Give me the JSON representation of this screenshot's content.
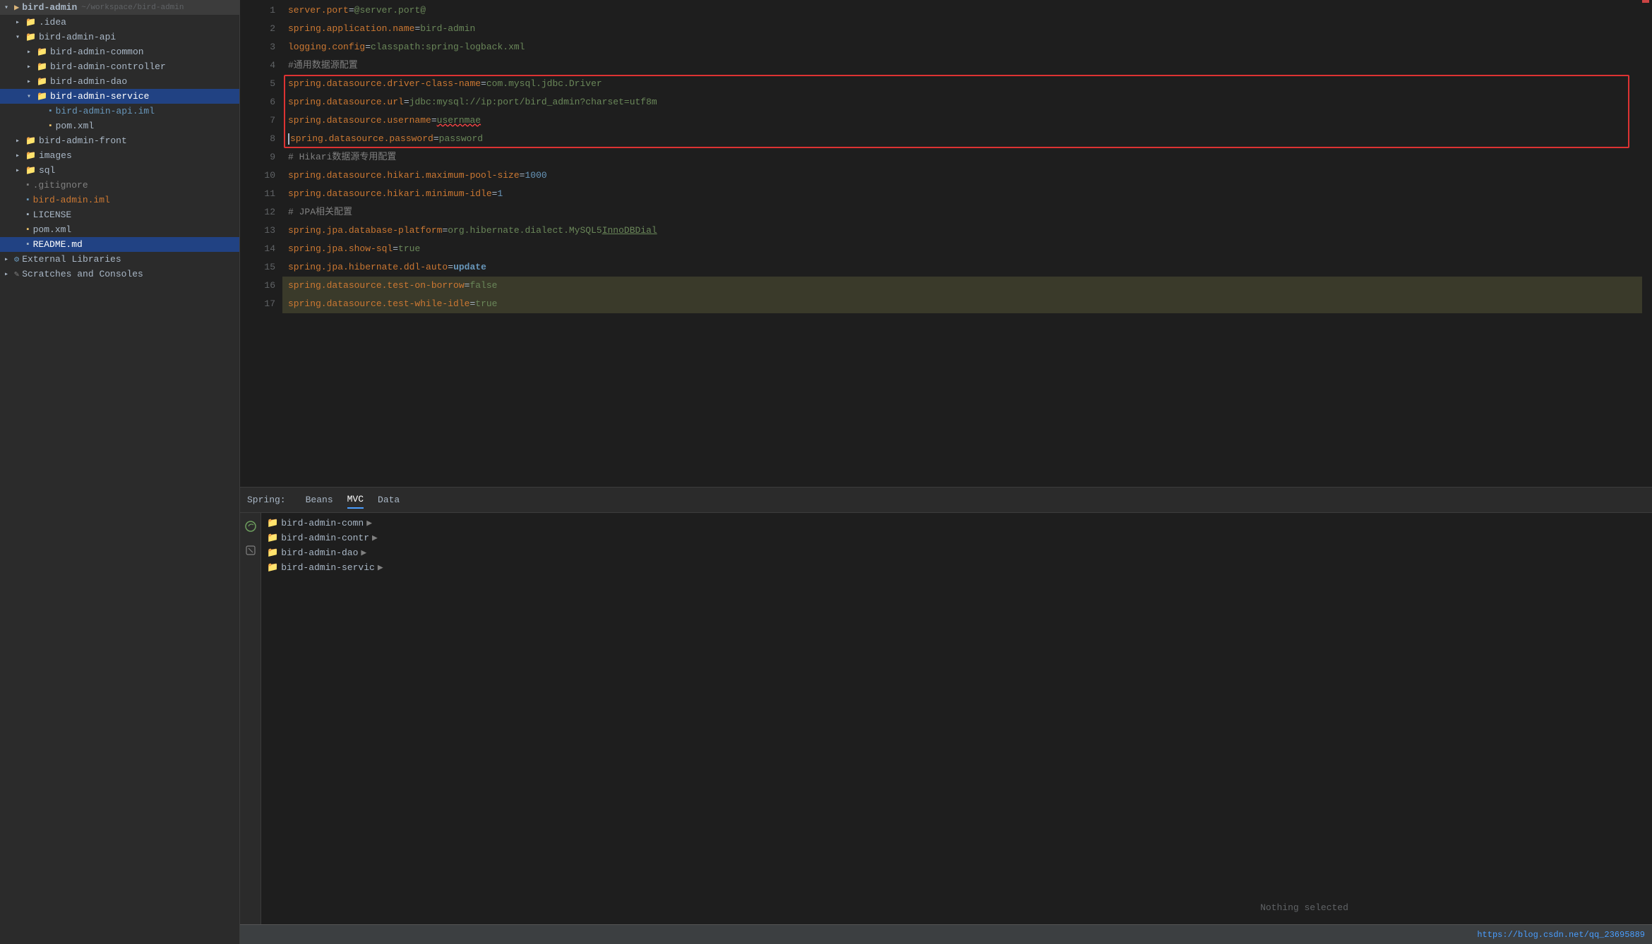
{
  "sidebar": {
    "root_label": "bird-admin",
    "root_path": "~/workspace/bird-admin",
    "items": [
      {
        "id": "idea",
        "label": ".idea",
        "type": "folder",
        "level": 1,
        "open": false
      },
      {
        "id": "bird-admin-api",
        "label": "bird-admin-api",
        "type": "folder",
        "level": 1,
        "open": true
      },
      {
        "id": "bird-admin-common",
        "label": "bird-admin-common",
        "type": "folder",
        "level": 2,
        "open": false
      },
      {
        "id": "bird-admin-controller",
        "label": "bird-admin-controller",
        "type": "folder",
        "level": 2,
        "open": false
      },
      {
        "id": "bird-admin-dao",
        "label": "bird-admin-dao",
        "type": "folder",
        "level": 2,
        "open": false
      },
      {
        "id": "bird-admin-service",
        "label": "bird-admin-service",
        "type": "folder",
        "level": 2,
        "open": true,
        "selected": true
      },
      {
        "id": "bird-admin-api-iml",
        "label": "bird-admin-api.iml",
        "type": "file-iml",
        "level": 3
      },
      {
        "id": "pom-xml-api",
        "label": "pom.xml",
        "type": "file-xml",
        "level": 3
      },
      {
        "id": "bird-admin-front",
        "label": "bird-admin-front",
        "type": "folder",
        "level": 1,
        "open": false
      },
      {
        "id": "images",
        "label": "images",
        "type": "folder",
        "level": 1,
        "open": false
      },
      {
        "id": "sql",
        "label": "sql",
        "type": "folder",
        "level": 1,
        "open": false
      },
      {
        "id": "gitignore",
        "label": ".gitignore",
        "type": "file-ignore",
        "level": 1
      },
      {
        "id": "bird-admin-iml",
        "label": "bird-admin.iml",
        "type": "file-iml-blue",
        "level": 1
      },
      {
        "id": "license",
        "label": "LICENSE",
        "type": "file",
        "level": 1
      },
      {
        "id": "pom-xml-root",
        "label": "pom.xml",
        "type": "file-xml",
        "level": 1
      },
      {
        "id": "readme-md",
        "label": "README.md",
        "type": "file-md",
        "level": 1,
        "selected": true
      },
      {
        "id": "external-libraries",
        "label": "External Libraries",
        "type": "ext-lib",
        "level": 0
      },
      {
        "id": "scratches-consoles",
        "label": "Scratches and Consoles",
        "type": "scratch",
        "level": 0
      }
    ]
  },
  "editor": {
    "lines": [
      {
        "num": 1,
        "content_raw": "server.port=@server.port@",
        "parts": [
          {
            "text": "server.port",
            "cls": "prop-key"
          },
          {
            "text": "=",
            "cls": ""
          },
          {
            "text": "@server.port@",
            "cls": "prop-val"
          }
        ]
      },
      {
        "num": 2,
        "content_raw": "spring.application.name=bird-admin",
        "parts": [
          {
            "text": "spring.application.name",
            "cls": "prop-key"
          },
          {
            "text": "=",
            "cls": ""
          },
          {
            "text": "bird-admin",
            "cls": "prop-val"
          }
        ]
      },
      {
        "num": 3,
        "content_raw": "logging.config=classpath:spring-logback.xml",
        "parts": [
          {
            "text": "logging.config",
            "cls": "prop-key"
          },
          {
            "text": "=",
            "cls": ""
          },
          {
            "text": "classpath:spring-logback.xml",
            "cls": "prop-val"
          }
        ]
      },
      {
        "num": 4,
        "content_raw": "#通用数据源配置",
        "parts": [
          {
            "text": "#通用数据源配置",
            "cls": "comment"
          }
        ]
      },
      {
        "num": 5,
        "content_raw": "spring.datasource.driver-class-name=com.mysql.jdbc.Driver",
        "parts": [
          {
            "text": "spring.datasource.driver-class-name",
            "cls": "prop-key"
          },
          {
            "text": "=",
            "cls": ""
          },
          {
            "text": "com.mysql.jdbc.Driver",
            "cls": "prop-val"
          }
        ],
        "bordered": true
      },
      {
        "num": 6,
        "content_raw": "spring.datasource.url=jdbc:mysql://ip:port/bird_admin?charset=utf8m",
        "parts": [
          {
            "text": "spring.datasource.url",
            "cls": "prop-key"
          },
          {
            "text": "=",
            "cls": ""
          },
          {
            "text": "jdbc:mysql://ip:port/bird_admin?charset=utf8m",
            "cls": "prop-val"
          }
        ],
        "bordered": true
      },
      {
        "num": 7,
        "content_raw": "spring.datasource.username=usernmae",
        "parts": [
          {
            "text": "spring.datasource.username",
            "cls": "prop-key"
          },
          {
            "text": "=",
            "cls": ""
          },
          {
            "text": "usernmae",
            "cls": "prop-val err-underline"
          }
        ],
        "bordered": true
      },
      {
        "num": 8,
        "content_raw": "spring.datasource.password=password",
        "parts": [
          {
            "text": "spring.datasource.password",
            "cls": "prop-key"
          },
          {
            "text": "=",
            "cls": ""
          },
          {
            "text": "password",
            "cls": "prop-val"
          }
        ],
        "bordered": true,
        "cursor": true
      },
      {
        "num": 9,
        "content_raw": "# Hikari 数据源专用配置",
        "parts": [
          {
            "text": "# Hikari ",
            "cls": "comment"
          },
          {
            "text": "数据源专用配置",
            "cls": "comment"
          }
        ]
      },
      {
        "num": 10,
        "content_raw": "spring.datasource.hikari.maximum-pool-size=1000",
        "parts": [
          {
            "text": "spring.datasource.hikari.maximum-pool-size",
            "cls": "prop-key"
          },
          {
            "text": "=",
            "cls": ""
          },
          {
            "text": "1000",
            "cls": "prop-num"
          }
        ]
      },
      {
        "num": 11,
        "content_raw": "spring.datasource.hikari.minimum-idle=1",
        "parts": [
          {
            "text": "spring.datasource.hikari.minimum-idle",
            "cls": "prop-key"
          },
          {
            "text": "=",
            "cls": ""
          },
          {
            "text": "1",
            "cls": "prop-num"
          }
        ]
      },
      {
        "num": 12,
        "content_raw": "# JPA 相关配置",
        "parts": [
          {
            "text": "# JPA ",
            "cls": "comment"
          },
          {
            "text": "相关配置",
            "cls": "comment"
          }
        ]
      },
      {
        "num": 13,
        "content_raw": "spring.jpa.database-platform=org.hibernate.dialect.MySQL5InnoDBDial",
        "parts": [
          {
            "text": "spring.jpa.database-platform",
            "cls": "prop-key"
          },
          {
            "text": "=",
            "cls": ""
          },
          {
            "text": "org.hibernate.dialect.MySQL5InnoDBDial",
            "cls": "prop-val"
          }
        ]
      },
      {
        "num": 14,
        "content_raw": "spring.jpa.show-sql=true",
        "parts": [
          {
            "text": "spring.jpa.show-sql",
            "cls": "prop-key"
          },
          {
            "text": "=",
            "cls": ""
          },
          {
            "text": "true",
            "cls": "prop-val"
          }
        ]
      },
      {
        "num": 15,
        "content_raw": "spring.jpa.hibernate.ddl-auto=update",
        "parts": [
          {
            "text": "spring.jpa.hibernate.ddl-auto",
            "cls": "prop-key"
          },
          {
            "text": "=",
            "cls": ""
          },
          {
            "text": "update",
            "cls": "highlight-val"
          }
        ]
      },
      {
        "num": 16,
        "content_raw": "spring.datasource.test-on-borrow=false",
        "parts": [
          {
            "text": "spring.datasource.test-on-borrow",
            "cls": "prop-key"
          },
          {
            "text": "=",
            "cls": ""
          },
          {
            "text": "false",
            "cls": "prop-val"
          }
        ],
        "line_selected": true
      },
      {
        "num": 17,
        "content_raw": "spring.datasource.test-while-idle=true",
        "parts": [
          {
            "text": "spring.datasource.test-while-idle",
            "cls": "prop-key"
          },
          {
            "text": "=",
            "cls": ""
          },
          {
            "text": "true",
            "cls": "prop-val"
          }
        ],
        "line_selected": true
      }
    ]
  },
  "bottom_panel": {
    "prefix": "Spring:",
    "tabs": [
      {
        "id": "beans",
        "label": "Beans",
        "active": false
      },
      {
        "id": "mvc",
        "label": "MVC",
        "active": true
      },
      {
        "id": "data",
        "label": "Data",
        "active": false
      }
    ],
    "tree_items": [
      {
        "label": "bird-admin-comn",
        "has_arrow": true
      },
      {
        "label": "bird-admin-contr",
        "has_arrow": true
      },
      {
        "label": "bird-admin-dao",
        "has_arrow": true
      },
      {
        "label": "bird-admin-servic",
        "has_arrow": true
      }
    ]
  },
  "status_bar": {
    "nothing_selected": "Nothing selected",
    "url": "https://blog.csdn.net/qq_23695889"
  },
  "icons": {
    "folder": "📁",
    "file": "📄",
    "arrow_open": "▾",
    "arrow_closed": "▸"
  }
}
